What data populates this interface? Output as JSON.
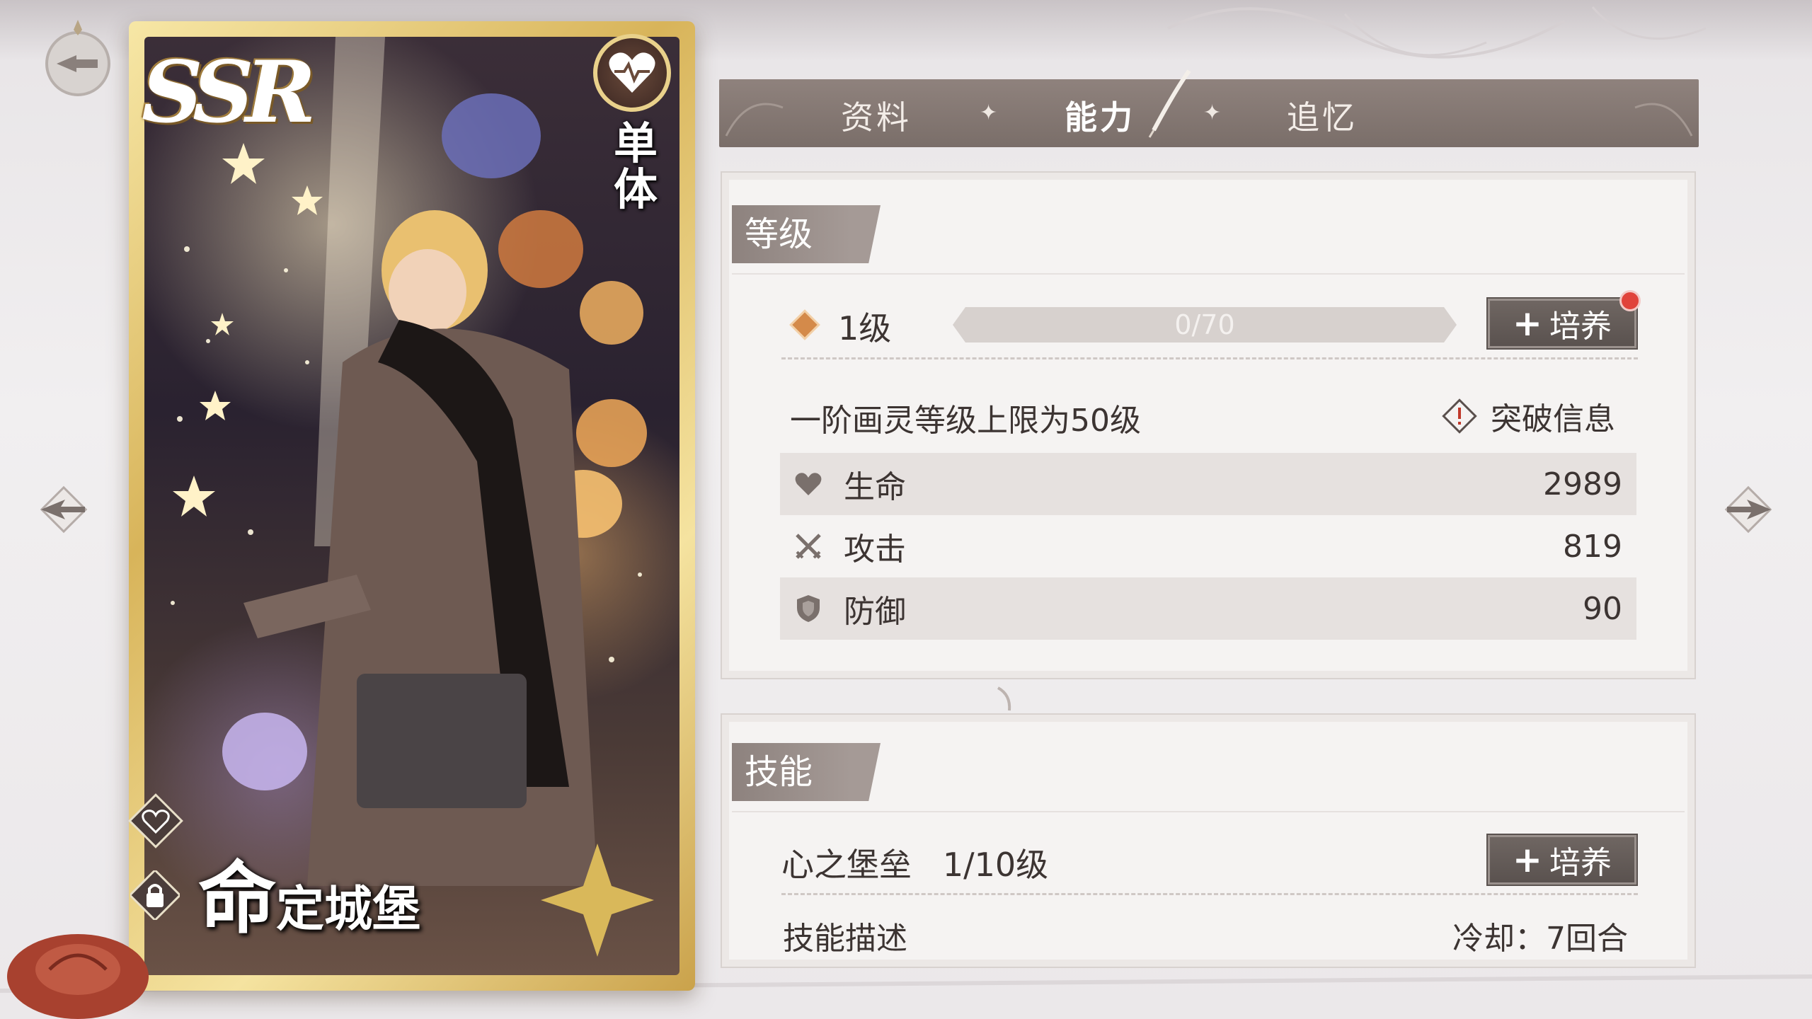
{
  "card": {
    "rarity": "SSR",
    "target_type": "单体",
    "name_first": "命",
    "name_rest": "定城堡"
  },
  "tabs": [
    {
      "label": "资料",
      "active": false
    },
    {
      "label": "能力",
      "active": true
    },
    {
      "label": "追忆",
      "active": false
    }
  ],
  "level_section": {
    "title": "等级",
    "level": "1级",
    "xp_text": "0/70",
    "xp_fraction": 0,
    "train_label": "培养",
    "cap_text": "一阶画灵等级上限为50级",
    "breakthrough_label": "突破信息",
    "stats": [
      {
        "icon": "heart-icon",
        "label": "生命",
        "value": "2989"
      },
      {
        "icon": "crossed-swords-icon",
        "label": "攻击",
        "value": "819"
      },
      {
        "icon": "shield-icon",
        "label": "防御",
        "value": "90"
      }
    ]
  },
  "skill_section": {
    "title": "技能",
    "skill_name": "心之堡垒",
    "skill_level": "1/10级",
    "train_label": "培养",
    "desc_label": "技能描述",
    "cooldown": "冷却：7回合"
  },
  "colors": {
    "tab_bar": "#7f736e",
    "panel_bg": "#f5f3f2",
    "section_label": "#8d827e",
    "button": "#5f5753",
    "notify_dot": "#e0433b",
    "card_frame": "#d8b45a"
  }
}
